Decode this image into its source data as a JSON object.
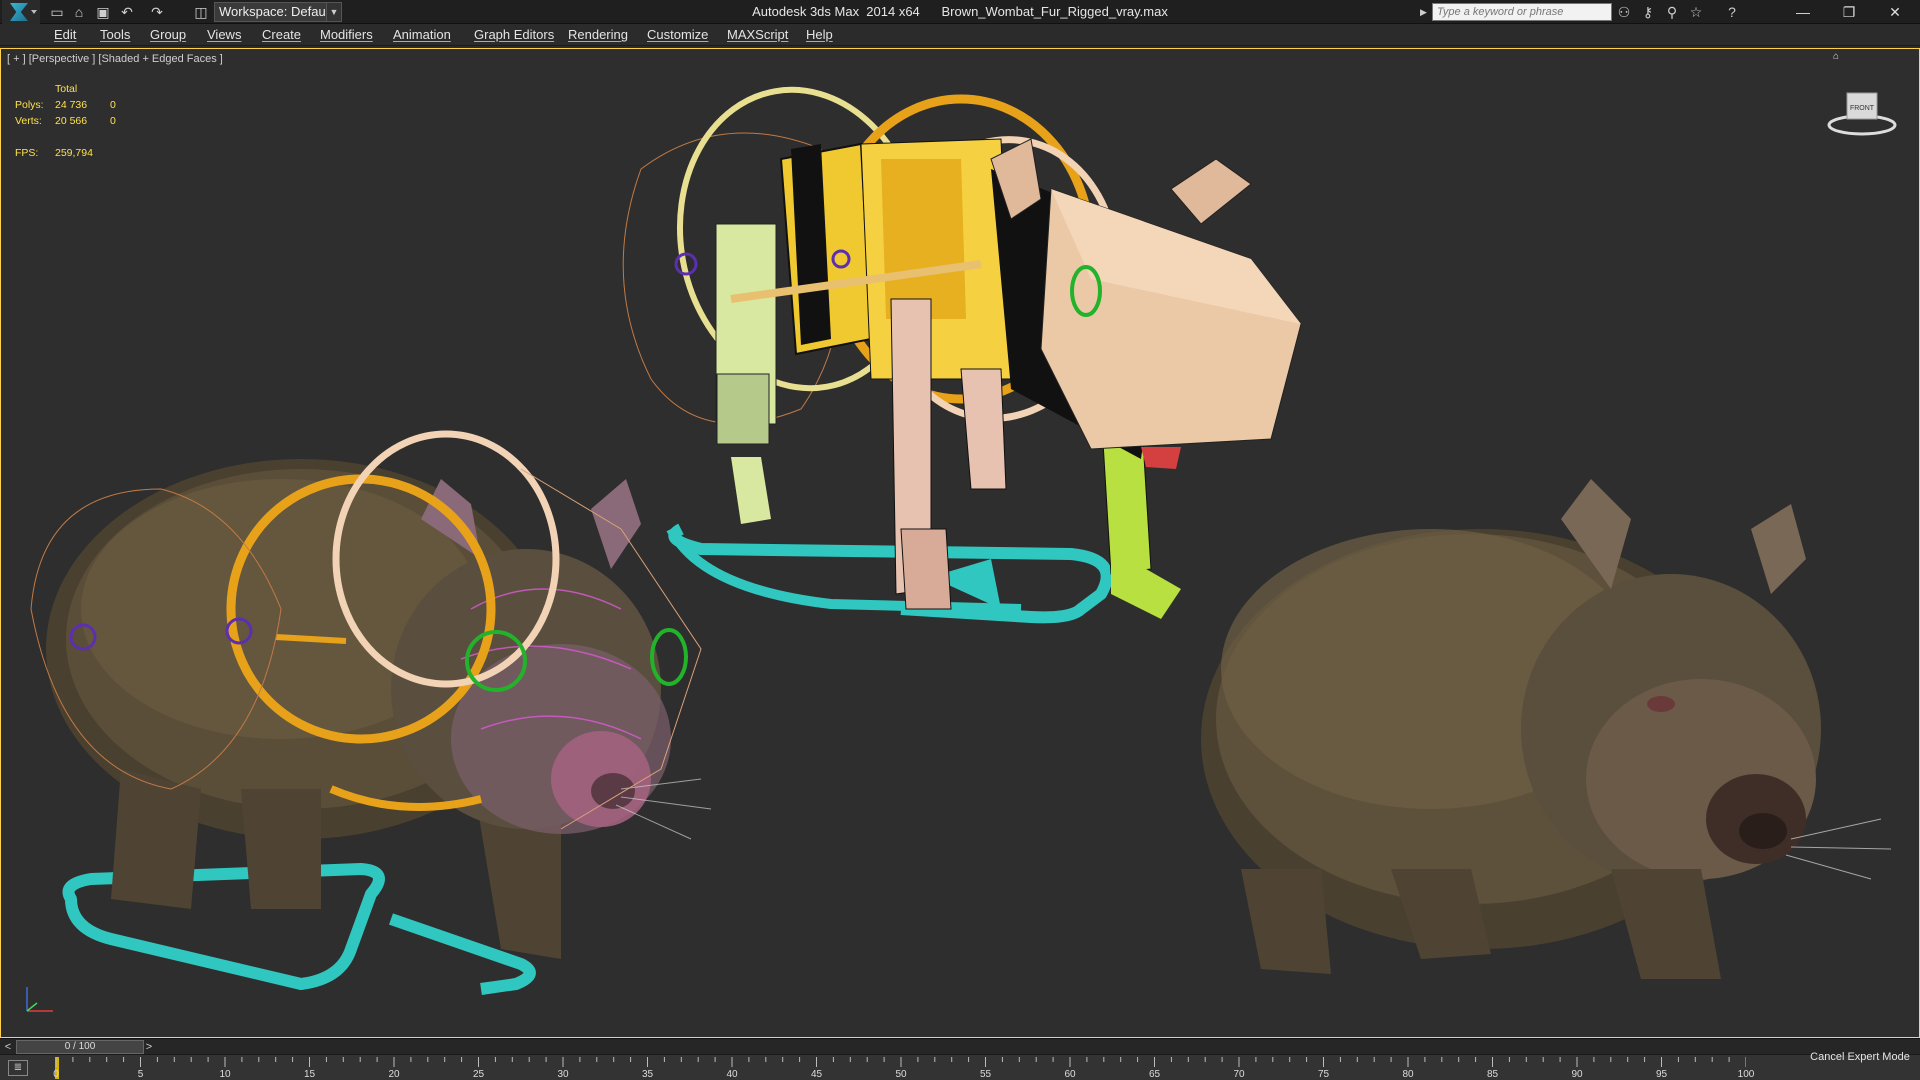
{
  "titlebar": {
    "workspace_label": "Workspace: Default",
    "window_title": "Autodesk 3ds Max  2014 x64      Brown_Wombat_Fur_Rigged_vray.max",
    "search_placeholder": "Type a keyword or phrase",
    "quick_access_icons": [
      "new-icon",
      "open-icon",
      "save-icon",
      "undo-icon",
      "redo-icon",
      "project-icon"
    ],
    "right_icons": [
      "binoculars-icon",
      "key-icon",
      "sign-in-icon",
      "star-icon",
      "help-icon"
    ],
    "window_buttons": {
      "minimize": "—",
      "restore": "❐",
      "close": "✕"
    }
  },
  "menubar": {
    "items": [
      "Edit",
      "Tools",
      "Group",
      "Views",
      "Create",
      "Modifiers",
      "Animation",
      "Graph Editors",
      "Rendering",
      "Customize",
      "MAXScript",
      "Help"
    ]
  },
  "viewport": {
    "label": "[ + ] [Perspective ] [Shaded + Edged Faces ]",
    "stats": {
      "header": "Total",
      "polys_label": "Polys:",
      "polys_value": "24 736",
      "polys_selected": "0",
      "verts_label": "Verts:",
      "verts_value": "20 566",
      "verts_selected": "0",
      "fps_label": "FPS:",
      "fps_value": "259,794"
    },
    "viewcube_label": "FRONT",
    "accent_color": "#ffd24a"
  },
  "timeline": {
    "prev": "<",
    "next": ">",
    "slider_text": "0 / 100",
    "current_frame": 0,
    "total_frames": 100,
    "tick_labels": [
      "0",
      "5",
      "10",
      "15",
      "20",
      "25",
      "30",
      "35",
      "40",
      "45",
      "50",
      "55",
      "60",
      "65",
      "70",
      "75",
      "80",
      "85",
      "90",
      "95",
      "100"
    ]
  },
  "status": {
    "cancel_expert": "Cancel Expert Mode"
  }
}
